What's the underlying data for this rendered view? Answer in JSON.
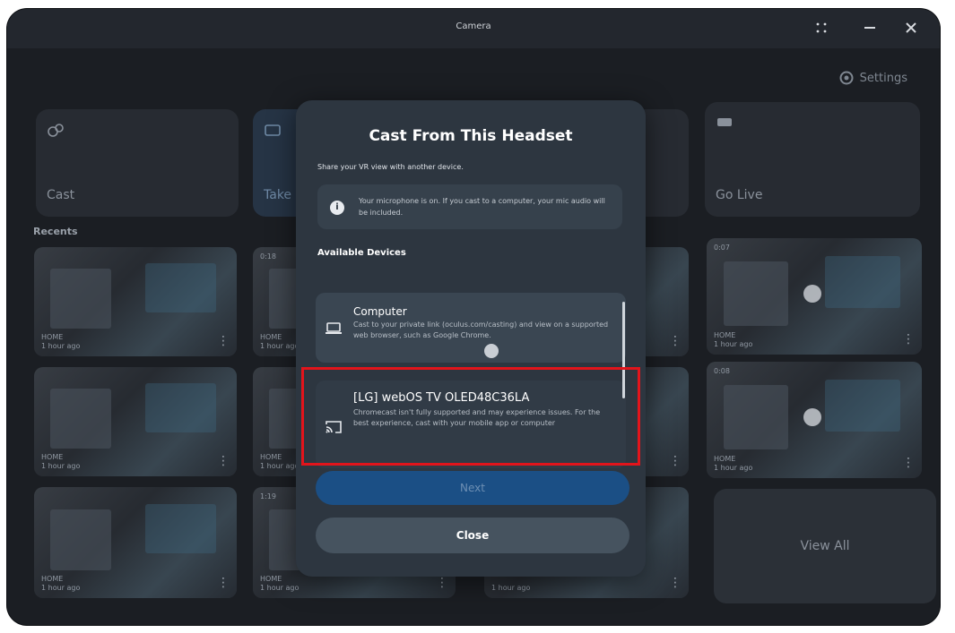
{
  "window": {
    "title": "Camera",
    "controls": {
      "grid": "grid-icon",
      "minimize": "minimize-icon",
      "close": "close-icon"
    }
  },
  "header": {
    "settings_label": "Settings",
    "settings_icon": "gear-icon"
  },
  "tiles": [
    {
      "label": "Cast",
      "icon": "cast-icon"
    },
    {
      "label": "Take",
      "icon": "camera-icon"
    },
    {
      "label": "Go Live",
      "icon": "live-icon"
    }
  ],
  "recents_label": "Recents",
  "thumbnails": [
    {
      "title": "HOME",
      "time": "1 hour ago",
      "duration": ""
    },
    {
      "title": "HOME",
      "time": "1 hour ago",
      "duration": "0:18"
    },
    {
      "title": "HOME",
      "time": "1 hour ago",
      "duration": "0:07"
    },
    {
      "title": "HOME",
      "time": "1 hour ago",
      "duration": ""
    },
    {
      "title": "HOME",
      "time": "1 hour ago",
      "duration": ""
    },
    {
      "title": "HOME",
      "time": "1 hour ago",
      "duration": "0:08"
    },
    {
      "title": "HOME",
      "time": "1 hour ago",
      "duration": ""
    },
    {
      "title": "HOME",
      "time": "1 hour ago",
      "duration": "1:19"
    },
    {
      "title": "",
      "time": "1 hour ago",
      "duration": ""
    }
  ],
  "view_all_label": "View All",
  "modal": {
    "title": "Cast From This Headset",
    "subtitle": "Share your VR view with another device.",
    "notice": "Your microphone is on. If you cast to a computer, your mic audio will be included.",
    "available_devices_label": "Available Devices",
    "devices": [
      {
        "name": "Computer",
        "description": "Cast to your private link (oculus.com/casting) and view on a supported web browser, such as Google Chrome.",
        "icon": "laptop-icon"
      },
      {
        "name": "[LG] webOS TV OLED48C36LA",
        "description": "Chromecast isn't fully supported and may experience issues. For the best experience, cast with your mobile app or computer",
        "icon": "chromecast-icon"
      }
    ],
    "next_label": "Next",
    "close_label": "Close"
  },
  "colors": {
    "highlight": "#e2141b",
    "modal_bg": "#2d3640",
    "next_button": "#1b4f85"
  }
}
